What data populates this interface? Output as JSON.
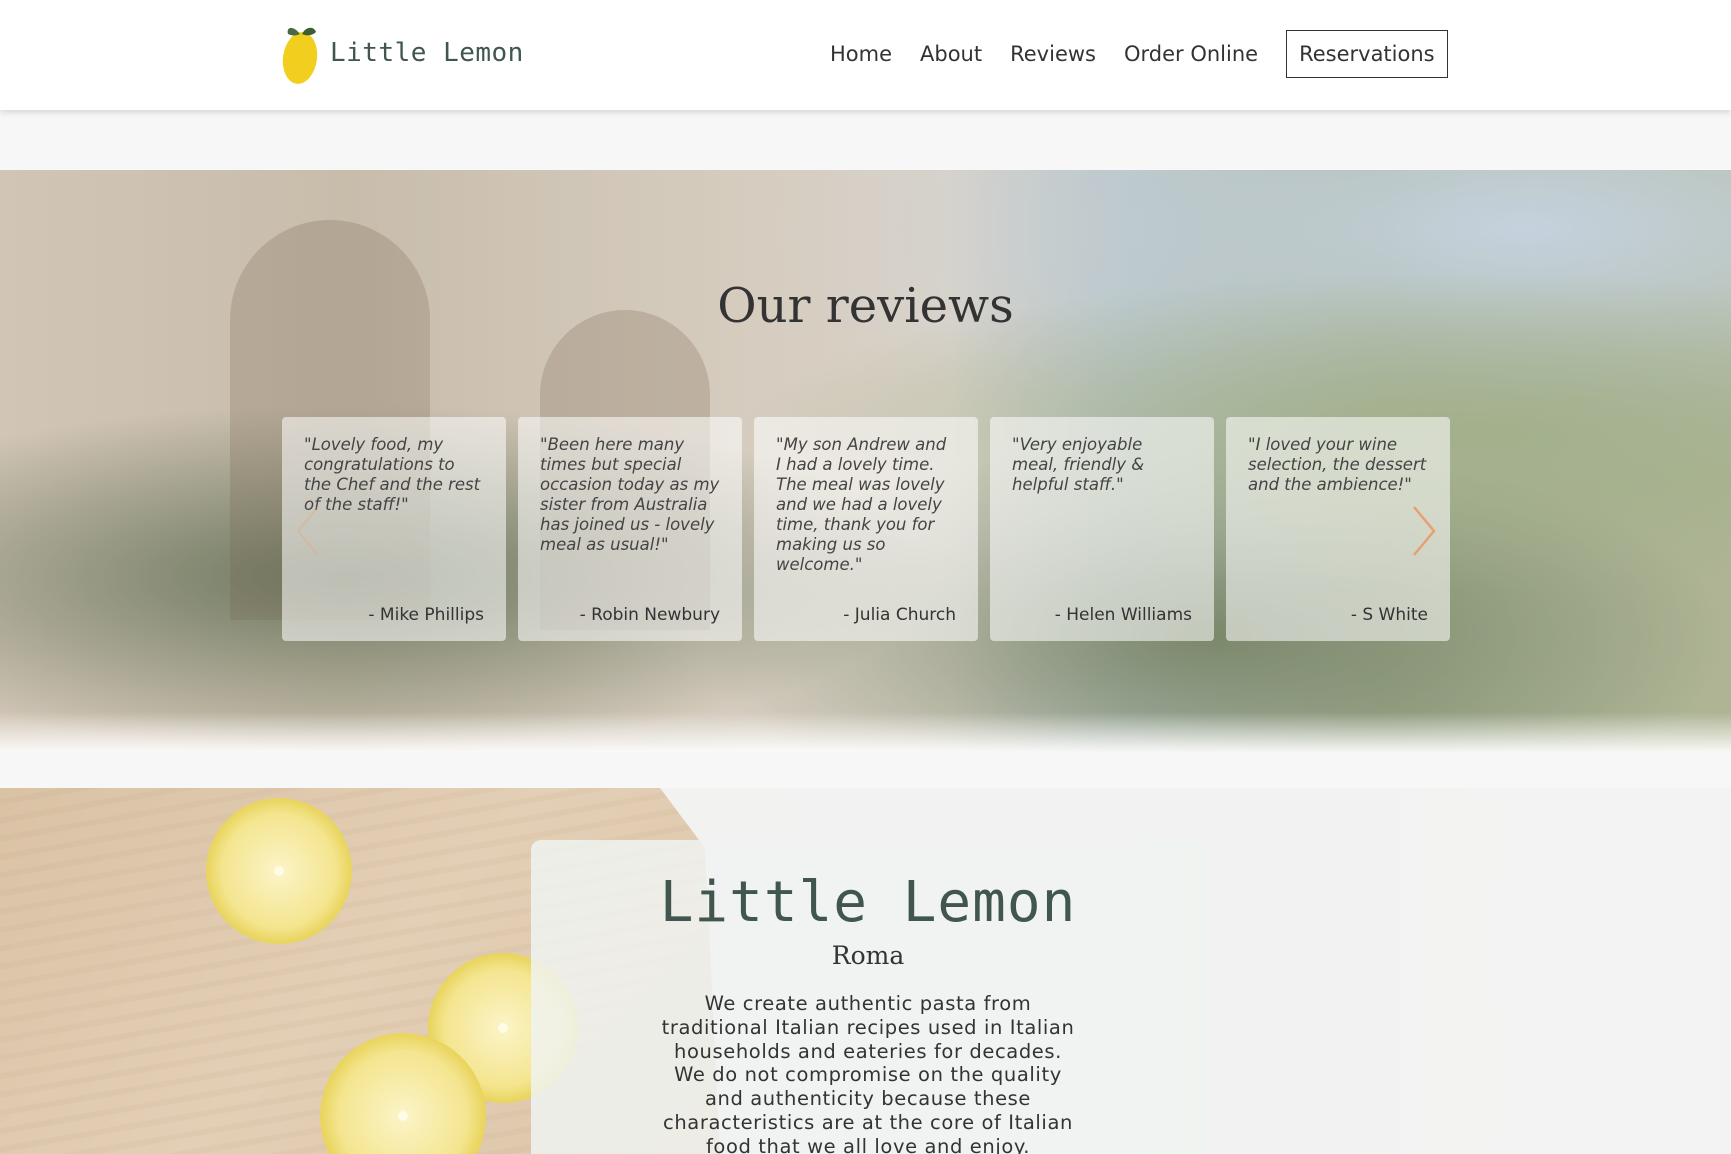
{
  "header": {
    "logo_text": "Little Lemon",
    "nav": [
      "Home",
      "About",
      "Reviews",
      "Order Online"
    ],
    "reservations_label": "Reservations"
  },
  "reviews": {
    "title": "Our reviews",
    "items": [
      {
        "quote": "\"Lovely food, my congratulations to the Chef and the rest of the staff!\"",
        "author": "- Mike Phillips"
      },
      {
        "quote": "\"Been here many times but special occasion today as my sister from Australia has joined us - lovely meal as usual!\"",
        "author": "- Robin Newbury"
      },
      {
        "quote": "\"My son Andrew and I had a lovely time. The meal was lovely and we had a lovely time, thank you for making us so welcome.\"",
        "author": "- Julia Church"
      },
      {
        "quote": "\"Very enjoyable meal, friendly & helpful staff.\"",
        "author": "- Helen Williams"
      },
      {
        "quote": "\"I loved your wine selection, the dessert and the ambience!\"",
        "author": "- S White"
      }
    ],
    "icons": {
      "prev": "chevron-left-icon",
      "next": "chevron-right-icon"
    },
    "arrow_color": "#e8a070"
  },
  "about": {
    "title": "Little Lemon",
    "subtitle": "Roma",
    "text": "We create authentic pasta from traditional Italian recipes used in Italian households and eateries for decades. We do not compromise on the quality and authenticity because these characteristics are at the core of Italian food that we all love and enjoy."
  },
  "colors": {
    "brand_green": "#40564f",
    "lemon_yellow": "#f4ce14"
  }
}
